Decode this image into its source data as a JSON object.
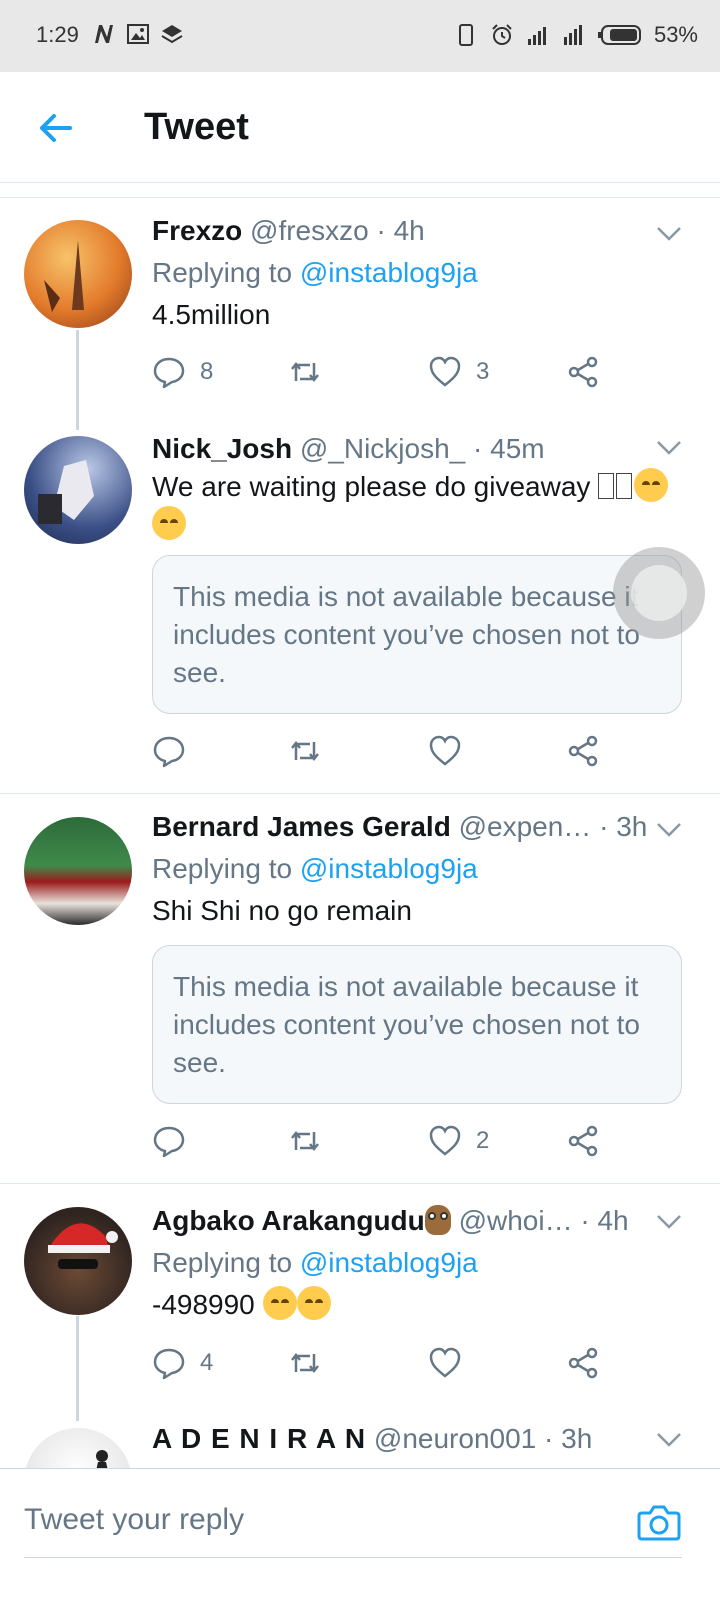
{
  "status_bar": {
    "time": "1:29",
    "battery": "53%"
  },
  "header": {
    "title": "Tweet"
  },
  "tweets": [
    {
      "name": "Frexzo",
      "handle": "@fresxzo",
      "time": "· 4h",
      "replying_prefix": "Replying to ",
      "replying_to": "@instablog9ja",
      "text": "4.5million",
      "replies": "8",
      "retweets": "",
      "likes": "3"
    },
    {
      "name": "Nick_Josh",
      "handle": "@_Nickjosh_",
      "time": "· 45m",
      "text": "We are waiting please do giveaway",
      "media_notice": "This media is not available because it includes content you’ve chosen not to see.",
      "replies": "",
      "retweets": "",
      "likes": ""
    },
    {
      "name": "Bernard James Gerald",
      "handle": "@expen…",
      "time": "· 3h",
      "replying_prefix": "Replying to ",
      "replying_to": "@instablog9ja",
      "text": "Shi Shi no go remain",
      "media_notice": "This media is not available because it includes content you’ve chosen not to see.",
      "replies": "",
      "retweets": "",
      "likes": "2"
    },
    {
      "name": "Agbako Arakangudu",
      "handle": "@whoi…",
      "time": "· 4h",
      "replying_prefix": "Replying to ",
      "replying_to": "@instablog9ja",
      "text": "-498990",
      "replies": "4",
      "retweets": "",
      "likes": ""
    },
    {
      "name": "A D E N I R A N",
      "handle": "@neuron001",
      "time": "· 3h"
    }
  ],
  "composer": {
    "placeholder": "Tweet your reply"
  },
  "colors": {
    "accent": "#1da1f2",
    "secondary_text": "#657786",
    "divider": "#e1e8ed"
  }
}
